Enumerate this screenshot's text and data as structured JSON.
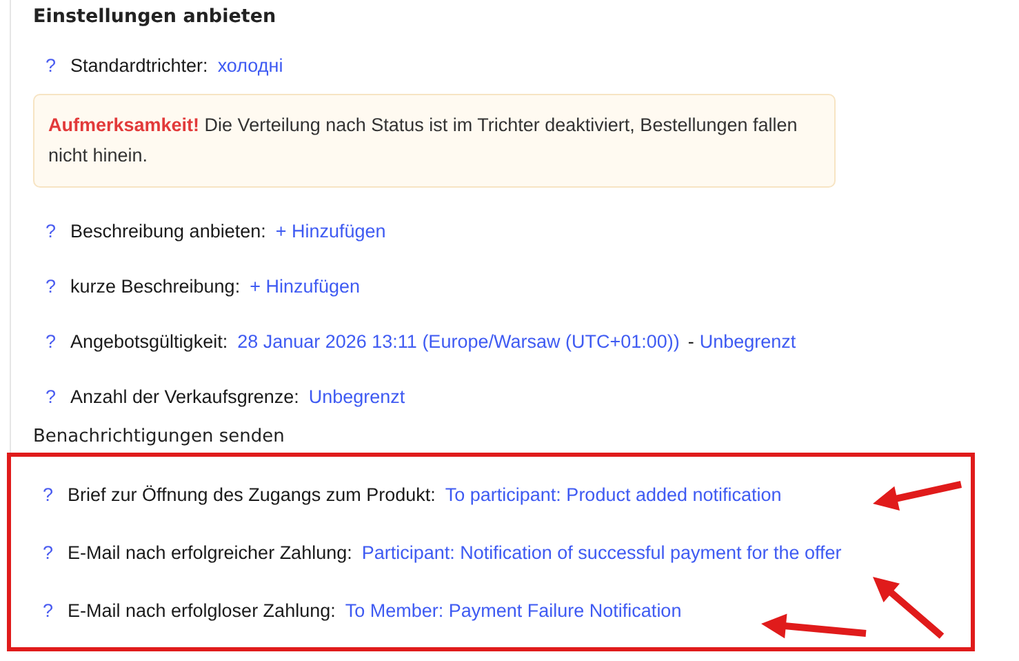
{
  "title": "Einstellungen anbieten",
  "funnel": {
    "help": "?",
    "label": "Standardtrichter:",
    "value": "холодні"
  },
  "notice": {
    "heading": "Aufmerksamkeit!",
    "text": "Die Verteilung nach Status ist im Trichter deaktiviert, Bestellungen fallen nicht hinein."
  },
  "settings": [
    {
      "help": "?",
      "label": "Beschreibung anbieten:",
      "values": [
        {
          "kind": "link",
          "text": "+ Hinzufügen"
        }
      ]
    },
    {
      "help": "?",
      "label": "kurze Beschreibung:",
      "values": [
        {
          "kind": "link",
          "text": "+ Hinzufügen"
        }
      ]
    },
    {
      "help": "?",
      "label": "Angebotsgültigkeit:",
      "values": [
        {
          "kind": "link",
          "text": "28 Januar 2026 13:11 (Europe/Warsaw (UTC+01:00))"
        },
        {
          "kind": "plain",
          "text": "-"
        },
        {
          "kind": "link",
          "text": "Unbegrenzt"
        }
      ]
    },
    {
      "help": "?",
      "label": "Anzahl der Verkaufsgrenze:",
      "values": [
        {
          "kind": "link",
          "text": "Unbegrenzt"
        }
      ]
    }
  ],
  "notifications": {
    "title": "Benachrichtigungen senden",
    "highlighted": true,
    "items": [
      {
        "help": "?",
        "label": "Brief zur Öffnung des Zugangs zum Produkt:",
        "values": [
          {
            "kind": "link",
            "text": "To participant: Product added notification"
          }
        ]
      },
      {
        "help": "?",
        "label": "E-Mail nach erfolgreicher Zahlung:",
        "values": [
          {
            "kind": "link",
            "text": "Participant: Notification of successful payment for the offer"
          }
        ]
      },
      {
        "help": "?",
        "label": "E-Mail nach erfolgloser Zahlung:",
        "values": [
          {
            "kind": "link",
            "text": "To Member: Payment Failure Notification"
          }
        ]
      }
    ]
  }
}
